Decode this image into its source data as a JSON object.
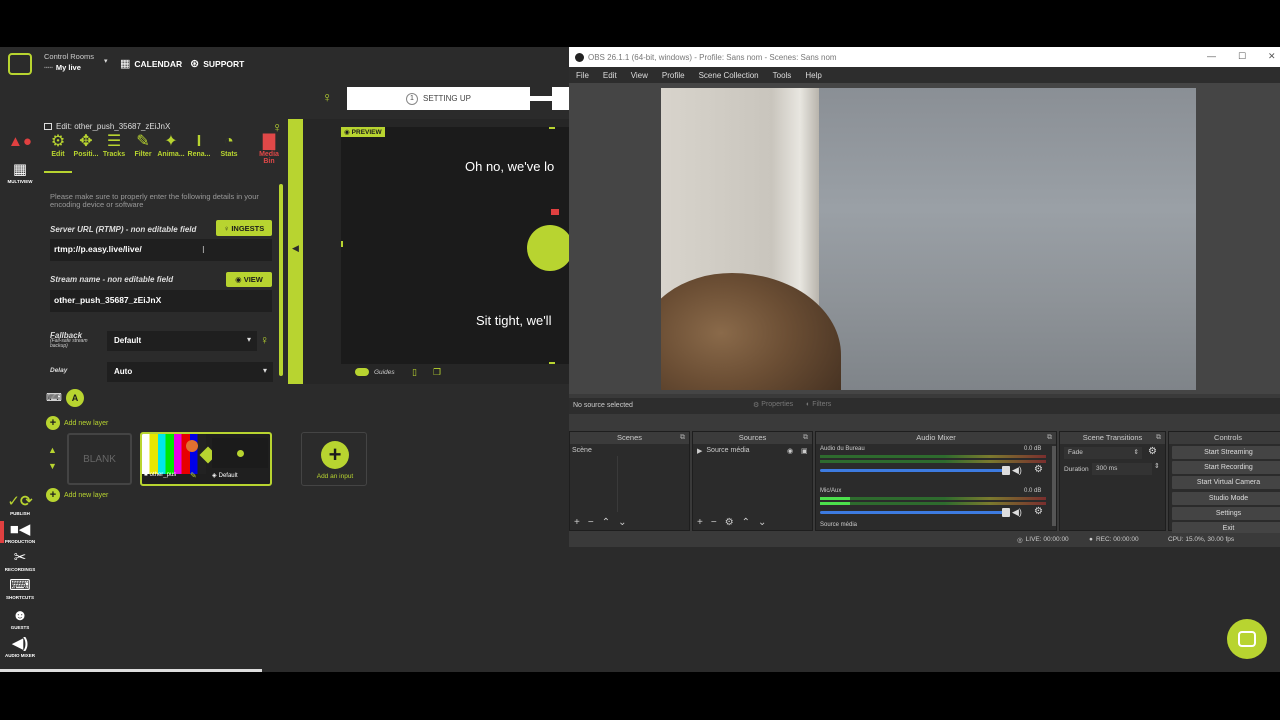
{
  "header": {
    "control_rooms": "Control Rooms",
    "my_live": "My live",
    "calendar": "CALENDAR",
    "support": "SUPPORT",
    "step_number": "1",
    "step_label": "SETTING UP"
  },
  "editor": {
    "title": "Edit: other_push_35687_zEiJnX",
    "tabs": [
      "Edit",
      "Positi...",
      "Tracks",
      "Filter",
      "Anima...",
      "Rena...",
      "Stats",
      "Media Bin"
    ],
    "instructions": "Please make sure to properly enter the following details in your encoding device or software",
    "server_label": "Server URL (RTMP) - non editable field",
    "ingests_btn": "INGESTS",
    "server_value": "rtmp://p.easy.live/live/",
    "stream_label": "Stream name - non editable field",
    "view_btn": "VIEW",
    "stream_value": "other_push_35687_zEiJnX",
    "fallback_label": "Fallback",
    "fallback_sub": "(Fail-safe stream backup)",
    "fallback_value": "Default",
    "delay_label": "Delay",
    "delay_value": "Auto"
  },
  "preview": {
    "badge": "PREVIEW",
    "headline": "Oh no, we've lo",
    "subline": "Sit tight, we'll",
    "guides": "Guides"
  },
  "sidebar": {
    "top_label": "MULTIVIEW",
    "publish": "PUBLISH",
    "production": "PRODUCTION",
    "recordings": "RECORDINGS",
    "shortcuts": "SHORTCUTS",
    "guests": "GUESTS",
    "audio_mixer": "AUDIO MIXER"
  },
  "layers": {
    "add_new_layer": "Add new layer",
    "blank": "BLANK",
    "card_left": "other_pus",
    "card_right": "Default",
    "add_input": "Add an input",
    "keyboard_badge": "A"
  },
  "obs": {
    "title": "OBS 26.1.1 (64-bit, windows) - Profile: Sans nom - Scenes: Sans nom",
    "menu": [
      "File",
      "Edit",
      "View",
      "Profile",
      "Scene Collection",
      "Tools",
      "Help"
    ],
    "no_source": "No source selected",
    "properties": "Properties",
    "filters": "Filters",
    "docks": {
      "scenes": "Scenes",
      "sources": "Sources",
      "mixer": "Audio Mixer",
      "transitions": "Scene Transitions",
      "controls": "Controls"
    },
    "scene_item": "Scène",
    "source_item": "Source média",
    "mixer_ch1": "Audio du Bureau",
    "mixer_ch1_db": "0.0 dB",
    "mixer_ch2": "Mic/Aux",
    "mixer_ch2_db": "0.0 dB",
    "mixer_ch3": "Source média",
    "transition_value": "Fade",
    "duration_label": "Duration",
    "duration_value": "300 ms",
    "controls": [
      "Start Streaming",
      "Start Recording",
      "Start Virtual Camera",
      "Studio Mode",
      "Settings",
      "Exit"
    ],
    "status_live": "LIVE: 00:00:00",
    "status_rec": "REC: 00:00:00",
    "status_cpu": "CPU: 15.0%, 30.00 fps"
  }
}
